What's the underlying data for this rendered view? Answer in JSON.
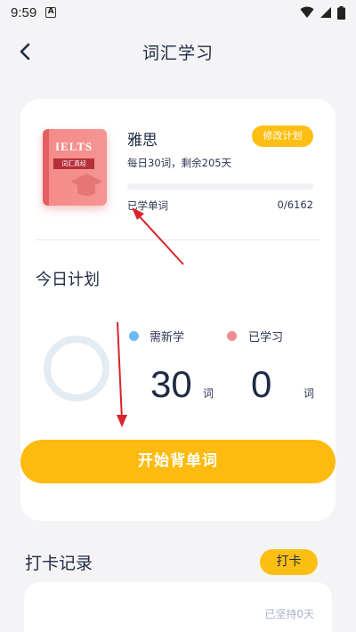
{
  "status_bar": {
    "time": "9:59",
    "app_badge": "A",
    "icons": [
      "wifi-icon",
      "signal-icon",
      "battery-icon"
    ]
  },
  "header": {
    "title": "词汇学习",
    "back_icon": "chevron-left-icon"
  },
  "plan": {
    "book_cover_title": "IELTS",
    "book_cover_subtitle": "词汇真经",
    "name": "雅思",
    "daily_info": "每日30词，剩余205天",
    "edit_button": "修改计划",
    "learned_label": "已学单词",
    "learned_count": "0/6162",
    "progress": 0
  },
  "today": {
    "title": "今日计划",
    "legend_new": "需新学",
    "legend_learned": "已学习",
    "new_count": "30",
    "learned_count": "0",
    "unit": "词",
    "start_button": "开始背单词"
  },
  "checkin": {
    "title": "打卡记录",
    "button": "打卡",
    "streak_text": "已坚持0天"
  },
  "colors": {
    "accent": "#fdbb0f",
    "new_dot": "#6bb9f5",
    "learned_dot": "#f28b8b",
    "annotation": "#d9232d"
  }
}
